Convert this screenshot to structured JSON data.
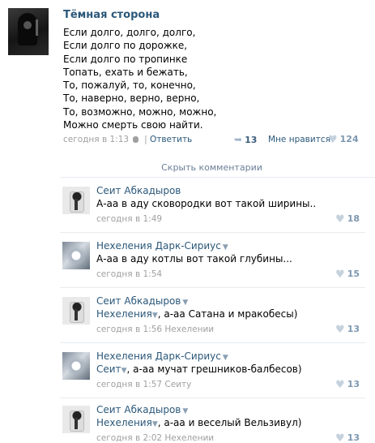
{
  "post": {
    "author": "Тёмная сторона",
    "lines": [
      "Если долго, долго, долго,",
      "Если долго по дорожке,",
      "Если долго по тропинке",
      "Топать, ехать и бежать,",
      "То, пожалуй, то, конечно,",
      "То, наверно, верно, верно,",
      "То, возможно, можно, можно,",
      "Можно смерть свою найти."
    ],
    "time": "сегодня в 1:13",
    "reply_label": "Ответить",
    "shares": "13",
    "likes_label": "Мне нравится",
    "likes": "124"
  },
  "toggle_comments_label": "Скрыть комментарии",
  "comments": [
    {
      "author": "Сеит Абкадыров",
      "pre": "",
      "mention": "",
      "text": "А-аа в аду сковородки вот такой ширины..",
      "time": "сегодня в 1:49",
      "reply_to": "",
      "likes": "18",
      "avatar": "seit"
    },
    {
      "author": "Нехеления Дарк-Сириус",
      "pre": "",
      "mention": "",
      "text": "А-аа в аду котлы вот такой глубины...",
      "time": "сегодня в 1:54",
      "reply_to": "",
      "likes": "15",
      "avatar": "nekh"
    },
    {
      "author": "Сеит Абкадыров",
      "mention": "Нехеления",
      "text": ", а-аа Сатана и мракобесы)",
      "time": "сегодня в 1:56",
      "reply_to": "Нехелении",
      "likes": "13",
      "avatar": "seit"
    },
    {
      "author": "Нехеления Дарк-Сириус",
      "mention": "Сеит",
      "text": ", а-аа мучат грешников-балбесов)",
      "time": "сегодня в 1:57",
      "reply_to": "Сеиту",
      "likes": "13",
      "avatar": "nekh"
    },
    {
      "author": "Сеит Абкадыров",
      "mention": "Нехеления",
      "text": ", а-аа и веселый Вельзивул)",
      "time": "сегодня в 2:02",
      "reply_to": "Нехелении",
      "likes": "13",
      "avatar": "seit"
    }
  ]
}
